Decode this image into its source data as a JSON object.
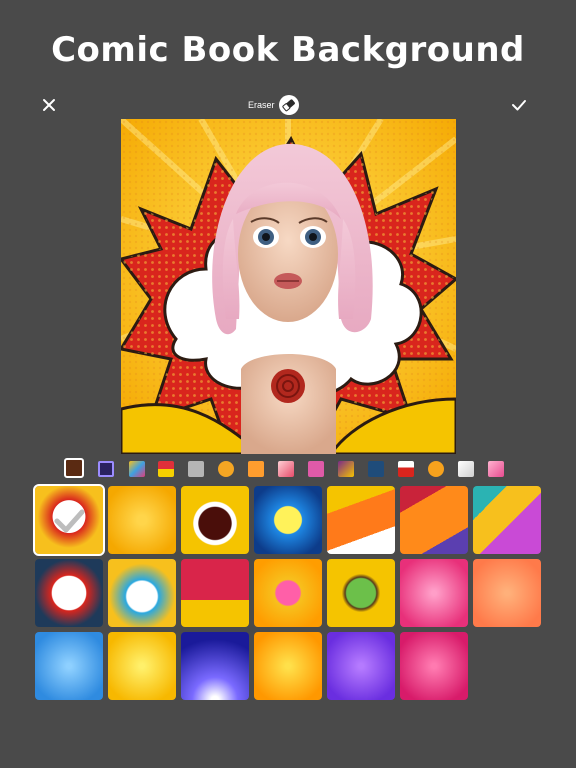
{
  "app": {
    "title": "Comic Book Background"
  },
  "toolbar": {
    "eraser_label": "Eraser",
    "close_icon": "close-icon",
    "confirm_icon": "check-icon"
  },
  "colors": {
    "background": "#4a4a4a",
    "text": "#ffffff",
    "comic_yellow": "#f7c01d",
    "comic_red": "#d9251d"
  },
  "filters": {
    "selected_index": 0,
    "count": 15
  },
  "backgrounds": {
    "selected_index": 0,
    "count": 20
  }
}
